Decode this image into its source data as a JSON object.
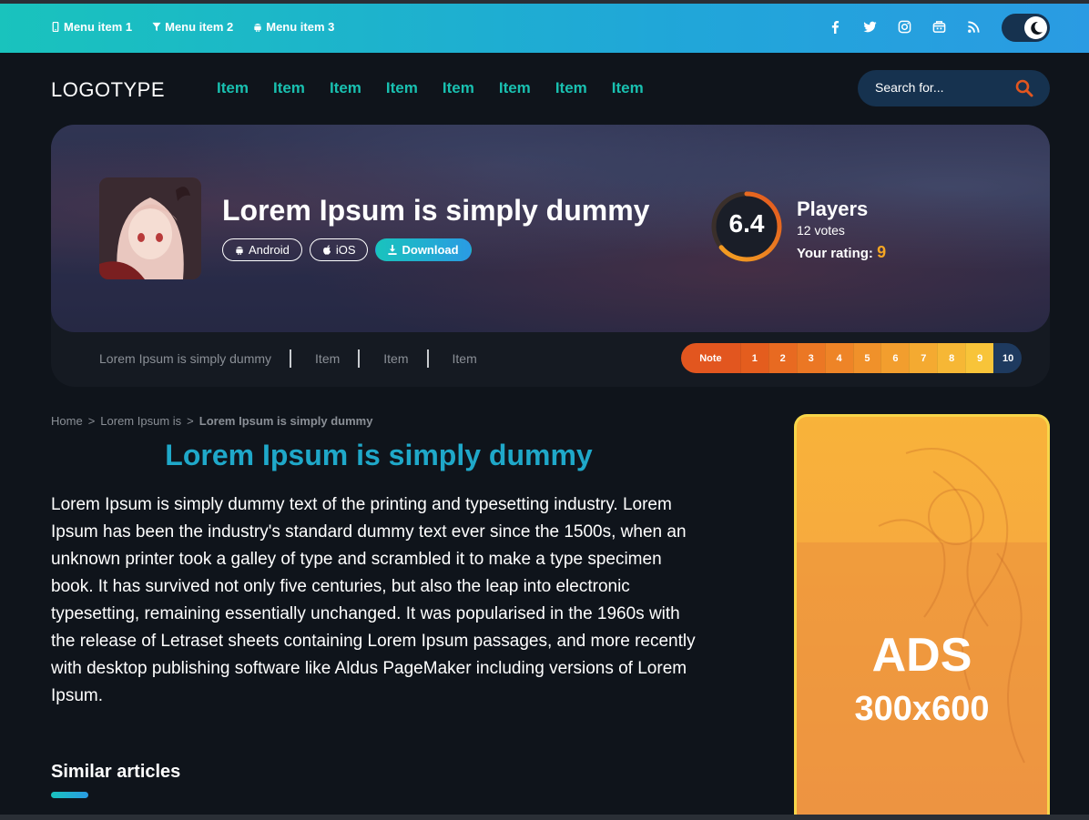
{
  "topbar": {
    "menu": [
      {
        "label": "Menu item 1",
        "icon": "mobile-icon"
      },
      {
        "label": "Menu item 2",
        "icon": "filter-icon"
      },
      {
        "label": "Menu item 3",
        "icon": "android-icon"
      }
    ],
    "social": [
      "facebook-icon",
      "twitter-icon",
      "instagram-icon",
      "store-icon",
      "rss-icon"
    ],
    "theme_toggle_icon": "moon-icon"
  },
  "header": {
    "logo": "LOGOTYPE",
    "nav": [
      "Item",
      "Item",
      "Item",
      "Item",
      "Item",
      "Item",
      "Item",
      "Item"
    ],
    "search_placeholder": "Search for..."
  },
  "hero": {
    "title": "Lorem Ipsum is simply dummy",
    "chips": {
      "android": "Android",
      "ios": "iOS",
      "download": "Download"
    },
    "score": "6.4",
    "score_fraction": 0.64,
    "players_label": "Players",
    "votes": "12 votes",
    "your_rating_label": "Your rating:",
    "your_rating_value": "9"
  },
  "subnav": {
    "items": [
      "Lorem Ipsum is simply dummy",
      "Item",
      "Item",
      "Item"
    ]
  },
  "note_bar": {
    "label": "Note",
    "values": [
      "1",
      "2",
      "3",
      "4",
      "5",
      "6",
      "7",
      "8",
      "9",
      "10"
    ],
    "colors": [
      "#e45d1e",
      "#e86a21",
      "#eb7724",
      "#ee8427",
      "#f0912a",
      "#f29e2e",
      "#f4aa31",
      "#f6b735",
      "#f8c439",
      "#1e3a5f"
    ]
  },
  "breadcrumb": {
    "home": "Home",
    "sep": ">",
    "parent": "Lorem Ipsum is",
    "current": "Lorem Ipsum is simply dummy"
  },
  "article": {
    "title": "Lorem Ipsum is simply dummy",
    "body": "Lorem Ipsum is simply dummy text of the printing and typesetting industry. Lorem Ipsum has been the industry's standard dummy text ever since the 1500s, when an unknown printer took a galley of type and scrambled it to make a type specimen book. It has survived not only five centuries, but also the leap into electronic typesetting, remaining essentially unchanged. It was popularised in the 1960s with the release of Letraset sheets containing Lorem Ipsum passages, and more recently with desktop publishing software like Aldus PageMaker including versions of Lorem Ipsum.",
    "similar_heading": "Similar articles"
  },
  "ad": {
    "label": "ADS",
    "size": "300x600"
  },
  "colors": {
    "accent": "#19c0b0",
    "accent_blue": "#2a9be3",
    "background": "#0f141b",
    "search_bg": "#16324f",
    "rating_orange": "#f5a623"
  }
}
